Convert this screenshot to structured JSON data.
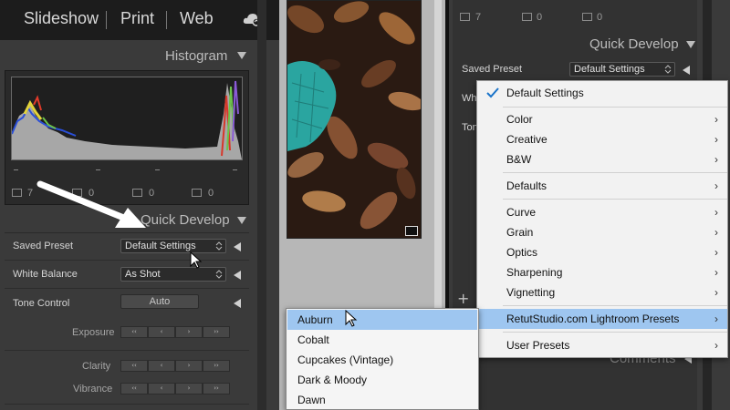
{
  "modules": {
    "slideshow": "Slideshow",
    "print": "Print",
    "web": "Web"
  },
  "histogram": {
    "title": "Histogram",
    "stats": [
      "7",
      "0",
      "0",
      "0"
    ]
  },
  "quick_develop": {
    "title": "Quick Develop",
    "saved_preset_label": "Saved Preset",
    "saved_preset_value": "Default Settings",
    "white_balance_label": "White Balance",
    "white_balance_value": "As Shot",
    "tone_control_label": "Tone Control",
    "auto_label": "Auto",
    "exposure_label": "Exposure",
    "clarity_label": "Clarity",
    "vibrance_label": "Vibrance",
    "step_labels": [
      "‹‹",
      "‹",
      "›",
      "››"
    ]
  },
  "right_panel": {
    "stats": [
      "7",
      "0",
      "0"
    ],
    "title": "Quick Develop",
    "saved_preset_label": "Saved Preset",
    "saved_preset_value": "Default Settings",
    "white_balance_label_trunc": "Wh",
    "tone_label_trunc": "Ton",
    "comments_label": "Comments"
  },
  "preset_menu": {
    "checked_item": "Default Settings",
    "items": [
      {
        "label": "Color",
        "arrow": "›"
      },
      {
        "label": "Creative",
        "arrow": "›"
      },
      {
        "label": "B&W",
        "arrow": "›"
      },
      {
        "label": "Defaults",
        "arrow": "›"
      },
      {
        "label": "Curve",
        "arrow": "›"
      },
      {
        "label": "Grain",
        "arrow": "›"
      },
      {
        "label": "Optics",
        "arrow": "›"
      },
      {
        "label": "Sharpening",
        "arrow": "›"
      },
      {
        "label": "Vignetting",
        "arrow": "›"
      },
      {
        "label": "RetutStudio.com Lightroom Presets",
        "arrow": "›"
      },
      {
        "label": "User Presets",
        "arrow": "›"
      }
    ]
  },
  "submenu": {
    "items": [
      "Auburn",
      "Cobalt",
      "Cupcakes (Vintage)",
      "Dark & Moody",
      "Dawn"
    ]
  },
  "colors": {
    "highlight": "#9ec6f0",
    "checkmark": "#1a73c9",
    "teal_fabric": "#2aa5a0"
  }
}
